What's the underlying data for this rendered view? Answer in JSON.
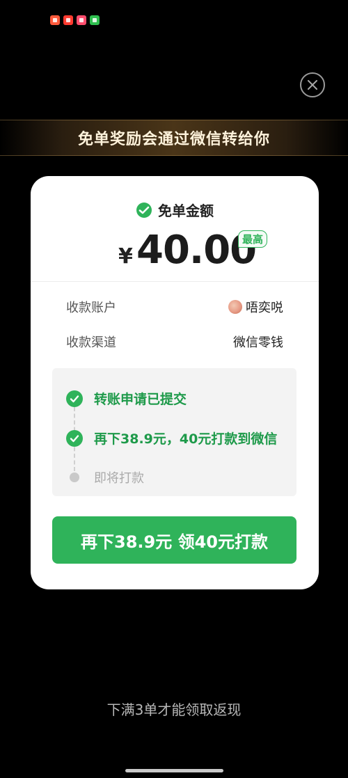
{
  "status_bar": {
    "app_icons": [
      "app-icon-1",
      "app-icon-2",
      "app-icon-3",
      "app-icon-4"
    ]
  },
  "banner": {
    "text": "免单奖励会通过微信转给你"
  },
  "card": {
    "amount_title": "免单金额",
    "currency": "¥",
    "amount": "40.00",
    "max_badge": "最高",
    "rows": [
      {
        "label": "收款账户",
        "value": "唔奕哾"
      },
      {
        "label": "收款渠道",
        "value": "微信零钱"
      }
    ],
    "steps": [
      {
        "text": "转账申请已提交",
        "status": "done"
      },
      {
        "text": "再下38.9元，40元打款到微信",
        "status": "done"
      },
      {
        "text": "即将打款",
        "status": "pending"
      }
    ],
    "cta_label": "再下38.9元 领40元打款"
  },
  "footer_hint": "下满3单才能领取返现",
  "colors": {
    "accent": "#2fb35a",
    "step_text": "#1e9a4a",
    "background": "#000000"
  }
}
